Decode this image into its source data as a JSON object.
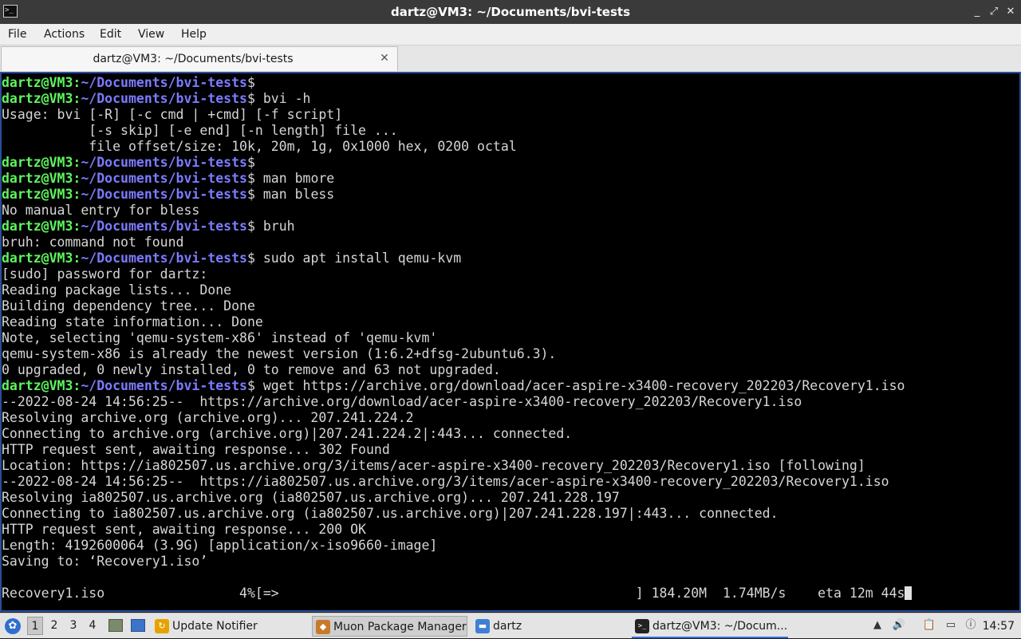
{
  "window": {
    "title": "dartz@VM3: ~/Documents/bvi-tests",
    "minimize_glyph": "_",
    "maximize_glyph": "⤢",
    "close_glyph": "✕"
  },
  "menu": [
    "File",
    "Actions",
    "Edit",
    "View",
    "Help"
  ],
  "tab": {
    "label": "dartz@VM3: ~/Documents/bvi-tests",
    "close_glyph": "✕"
  },
  "terminal": {
    "prompt_user": "dartz@VM3",
    "prompt_path": "~/Documents/bvi-tests",
    "prompt_suffix": "$",
    "lines": [
      {
        "prompt": true,
        "cmd": ""
      },
      {
        "prompt": true,
        "cmd": " bvi -h"
      },
      {
        "text": "Usage: bvi [-R] [-c cmd | +cmd] [-f script]"
      },
      {
        "text": "           [-s skip] [-e end] [-n length] file ..."
      },
      {
        "text": "           file offset/size: 10k, 20m, 1g, 0x1000 hex, 0200 octal"
      },
      {
        "prompt": true,
        "cmd": ""
      },
      {
        "prompt": true,
        "cmd": " man bmore"
      },
      {
        "prompt": true,
        "cmd": " man bless"
      },
      {
        "text": "No manual entry for bless"
      },
      {
        "prompt": true,
        "cmd": " bruh"
      },
      {
        "text": "bruh: command not found"
      },
      {
        "prompt": true,
        "cmd": " sudo apt install qemu-kvm"
      },
      {
        "text": "[sudo] password for dartz:"
      },
      {
        "text": "Reading package lists... Done"
      },
      {
        "text": "Building dependency tree... Done"
      },
      {
        "text": "Reading state information... Done"
      },
      {
        "text": "Note, selecting 'qemu-system-x86' instead of 'qemu-kvm'"
      },
      {
        "text": "qemu-system-x86 is already the newest version (1:6.2+dfsg-2ubuntu6.3)."
      },
      {
        "text": "0 upgraded, 0 newly installed, 0 to remove and 63 not upgraded."
      },
      {
        "prompt": true,
        "cmd": " wget https://archive.org/download/acer-aspire-x3400-recovery_202203/Recovery1.iso"
      },
      {
        "text": "--2022-08-24 14:56:25--  https://archive.org/download/acer-aspire-x3400-recovery_202203/Recovery1.iso"
      },
      {
        "text": "Resolving archive.org (archive.org)... 207.241.224.2"
      },
      {
        "text": "Connecting to archive.org (archive.org)|207.241.224.2|:443... connected."
      },
      {
        "text": "HTTP request sent, awaiting response... 302 Found"
      },
      {
        "text": "Location: https://ia802507.us.archive.org/3/items/acer-aspire-x3400-recovery_202203/Recovery1.iso [following]"
      },
      {
        "text": "--2022-08-24 14:56:25--  https://ia802507.us.archive.org/3/items/acer-aspire-x3400-recovery_202203/Recovery1.iso"
      },
      {
        "text": "Resolving ia802507.us.archive.org (ia802507.us.archive.org)... 207.241.228.197"
      },
      {
        "text": "Connecting to ia802507.us.archive.org (ia802507.us.archive.org)|207.241.228.197|:443... connected."
      },
      {
        "text": "HTTP request sent, awaiting response... 200 OK"
      },
      {
        "text": "Length: 4192600064 (3.9G) [application/x-iso9660-image]"
      },
      {
        "text": "Saving to: ‘Recovery1.iso’"
      },
      {
        "text": ""
      },
      {
        "text": "Recovery1.iso                 4%[=>                                             ] 184.20M  1.74MB/s    eta 12m 44s",
        "cursor": true
      }
    ]
  },
  "taskbar": {
    "workspaces": [
      "1",
      "2",
      "3",
      "4"
    ],
    "active_workspace": 0,
    "tasks": [
      {
        "label": "Update Notifier",
        "icon": "update-notifier-icon",
        "icon_glyph": "↻",
        "color": "#e8a200"
      },
      {
        "label": "Muon Package Manager",
        "icon": "muon-package-icon",
        "icon_glyph": "◆",
        "color": "#c87a2a"
      },
      {
        "label": "dartz",
        "icon": "folder-icon",
        "icon_glyph": "▬",
        "color": "#3f7fd6"
      },
      {
        "label": "dartz@VM3: ~/Docum...",
        "icon": "terminal-icon",
        "icon_glyph": ">_",
        "color": "#222222"
      }
    ],
    "clock": "14:57"
  }
}
